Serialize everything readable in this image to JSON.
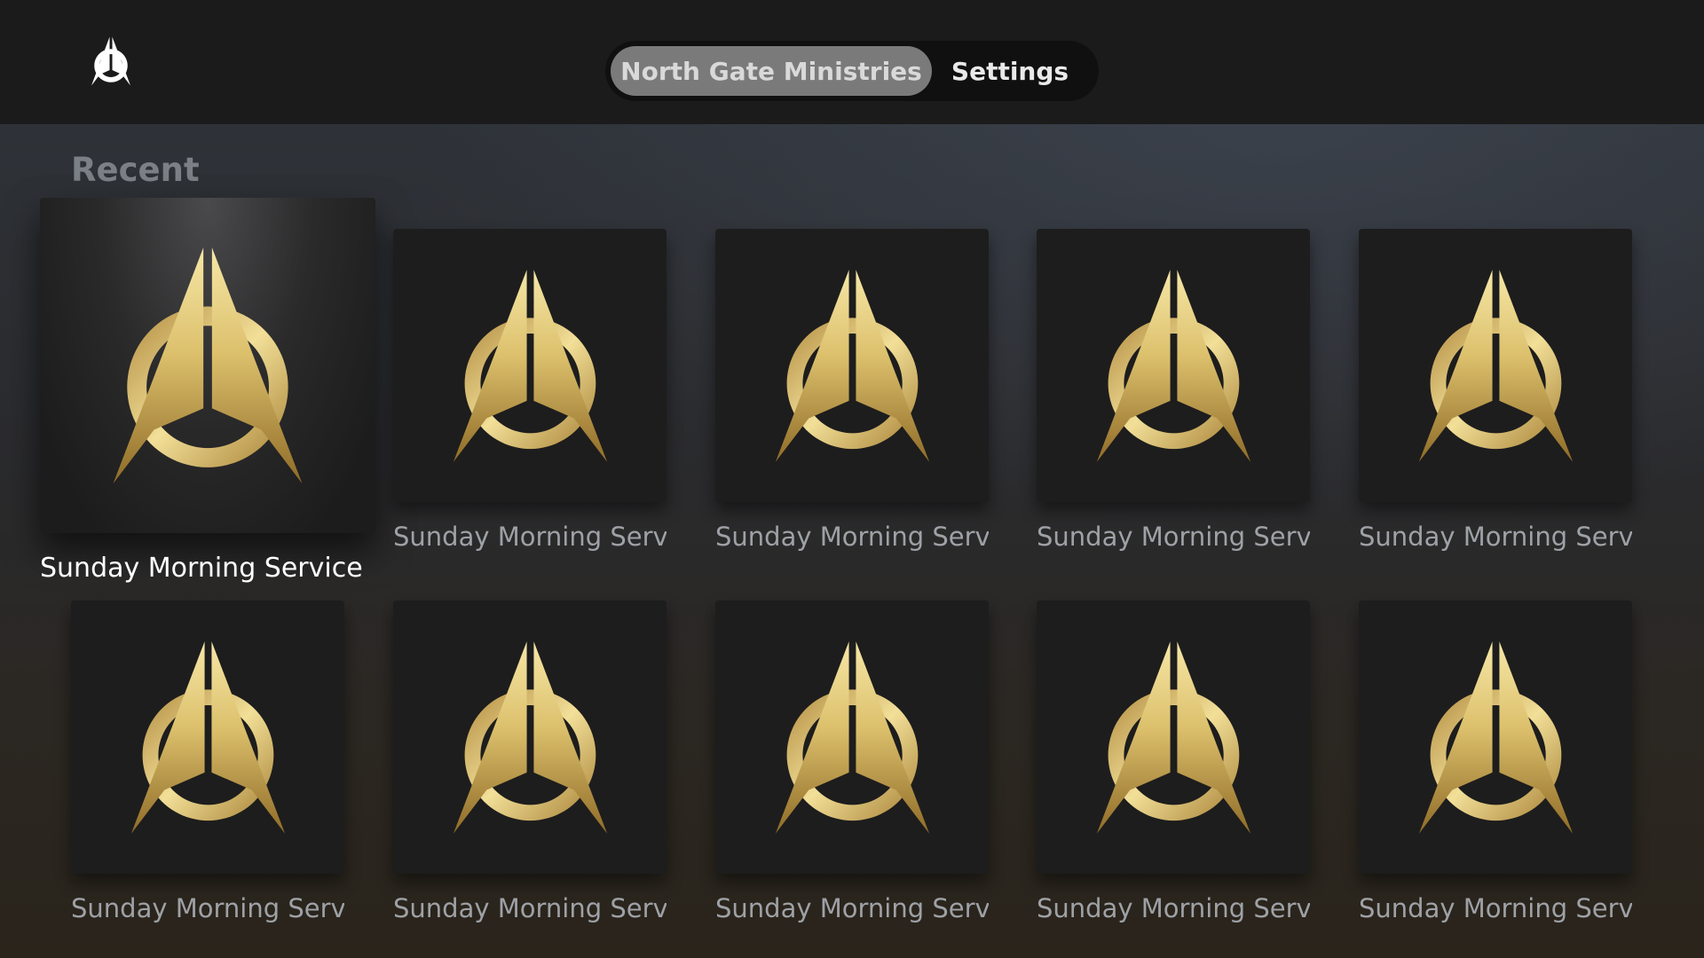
{
  "header": {
    "logo_icon": "compass-logo-icon",
    "tabs": [
      {
        "label": "North Gate Ministries",
        "active": true
      },
      {
        "label": "Settings",
        "active": false
      }
    ]
  },
  "section": {
    "title": "Recent"
  },
  "items": [
    {
      "title": "Sunday Morning Service",
      "focused": true
    },
    {
      "title": "Sunday Morning Service",
      "focused": false
    },
    {
      "title": "Sunday Morning Service",
      "focused": false
    },
    {
      "title": "Sunday Morning Service",
      "focused": false
    },
    {
      "title": "Sunday Morning Service",
      "focused": false
    },
    {
      "title": "Sunday Morning Service",
      "focused": false
    },
    {
      "title": "Sunday Morning Service",
      "focused": false
    },
    {
      "title": "Sunday Morning Service",
      "focused": false
    },
    {
      "title": "Sunday Morning Service",
      "focused": false
    },
    {
      "title": "Sunday Morning Service",
      "focused": false
    }
  ],
  "colors": {
    "gold_light": "#f3e29a",
    "gold_mid": "#d6b25a",
    "gold_dark": "#8c6a2a",
    "topbar": "#1b1b1b"
  }
}
